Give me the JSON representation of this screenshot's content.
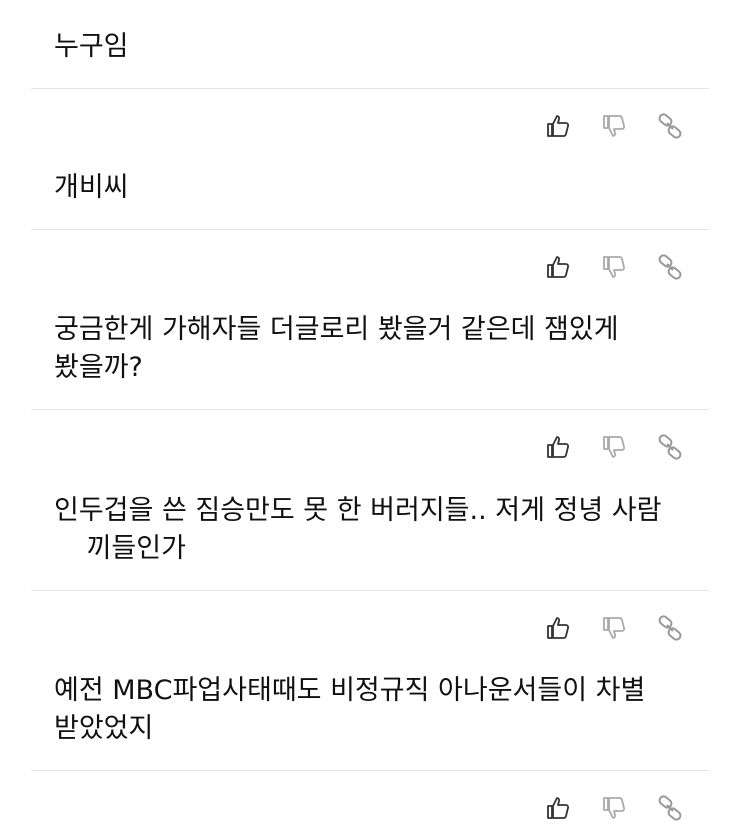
{
  "comments": [
    {
      "text": "누구임"
    },
    {
      "text": "개비씨"
    },
    {
      "text": "궁금한게 가해자들 더글로리 봤을거 같은데 잼있게 봤을까?"
    },
    {
      "text_a": "인두겁을 쓴 짐승만도 못 한 버러지들.. 저게 정녕 사람",
      "text_b": "끼들인가"
    },
    {
      "text": "예전 MBC파업사태때도 비정규직 아나운서들이 차별 받았었지"
    }
  ],
  "actions": {
    "like_icon": "thumbs-up-icon",
    "dislike_icon": "thumbs-down-icon",
    "link_icon": "link-icon"
  },
  "colors": {
    "text": "#111111",
    "like": "#333333",
    "dislike": "#aaaaaa",
    "link": "#999999",
    "divider": "#e4e4e4"
  }
}
